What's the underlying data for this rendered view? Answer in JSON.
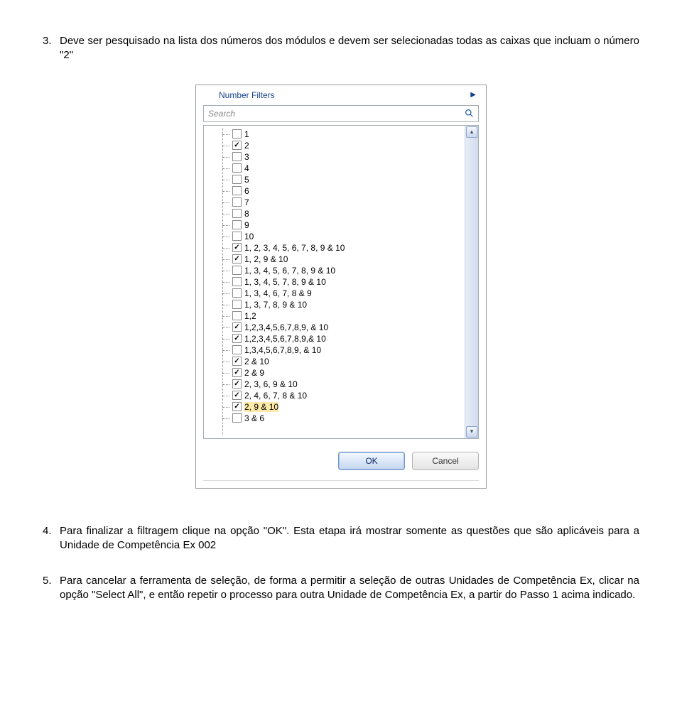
{
  "paragraphs": {
    "p3_num": "3.",
    "p3_text": "Deve ser pesquisado na lista dos números dos módulos e devem ser selecionadas todas as caixas que incluam o número \"2\"",
    "p4_num": "4.",
    "p4_text": "Para finalizar a filtragem clique na opção \"OK\". Esta etapa irá mostrar somente as questões que são aplicáveis para a Unidade de Competência Ex 002",
    "p5_num": "5.",
    "p5_text": "Para cancelar a ferramenta de seleção, de forma a permitir a seleção de outras Unidades de Competência Ex, clicar na opção \"Select All\", e então repetir o processo para outra Unidade de Competência Ex, a partir do Passo 1 acima indicado."
  },
  "filter": {
    "number_filters_label": "Number Filters",
    "search_placeholder": "Search",
    "items": [
      {
        "label": "1",
        "checked": false
      },
      {
        "label": "2",
        "checked": true
      },
      {
        "label": "3",
        "checked": false
      },
      {
        "label": "4",
        "checked": false
      },
      {
        "label": "5",
        "checked": false
      },
      {
        "label": "6",
        "checked": false
      },
      {
        "label": "7",
        "checked": false
      },
      {
        "label": "8",
        "checked": false
      },
      {
        "label": "9",
        "checked": false
      },
      {
        "label": "10",
        "checked": false
      },
      {
        "label": "1, 2, 3, 4, 5, 6, 7, 8, 9 & 10",
        "checked": true
      },
      {
        "label": "1, 2, 9 & 10",
        "checked": true
      },
      {
        "label": "1, 3, 4, 5, 6, 7, 8, 9 & 10",
        "checked": false
      },
      {
        "label": "1, 3, 4, 5, 7, 8, 9 & 10",
        "checked": false
      },
      {
        "label": "1, 3, 4, 6, 7, 8 & 9",
        "checked": false
      },
      {
        "label": "1, 3, 7, 8, 9 & 10",
        "checked": false
      },
      {
        "label": "1,2",
        "checked": false
      },
      {
        "label": "1,2,3,4,5,6,7,8,9, & 10",
        "checked": true
      },
      {
        "label": "1,2,3,4,5,6,7,8,9,& 10",
        "checked": true
      },
      {
        "label": "1,3,4,5,6,7,8,9, & 10",
        "checked": false
      },
      {
        "label": "2 & 10",
        "checked": true
      },
      {
        "label": "2 & 9",
        "checked": true
      },
      {
        "label": "2, 3, 6, 9 & 10",
        "checked": true
      },
      {
        "label": "2, 4, 6, 7, 8 & 10",
        "checked": true
      },
      {
        "label": "2, 9 & 10",
        "checked": true,
        "highlight": true
      },
      {
        "label": "3 & 6",
        "checked": false
      }
    ],
    "ok_label": "OK",
    "cancel_label": "Cancel"
  }
}
